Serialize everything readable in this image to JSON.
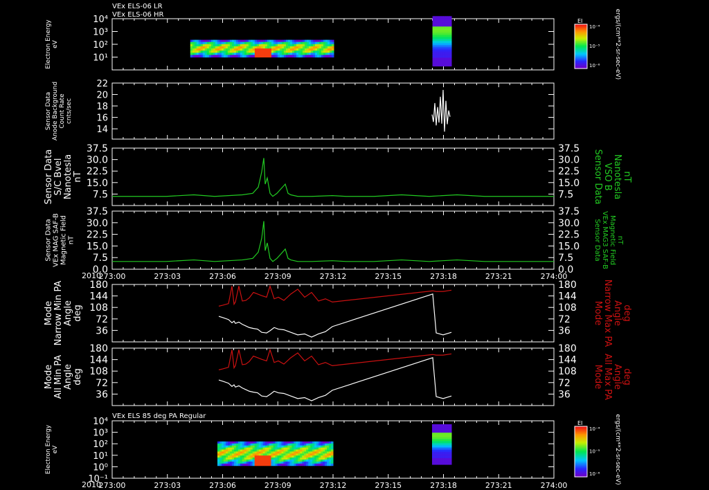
{
  "colors": {
    "background": "#000000",
    "axis": "#ffffff",
    "mag": "#22cc22",
    "maxpa": "#cc1111",
    "minpa": "#ffffff",
    "green_label": "#22cc22",
    "red_label": "#cc1111"
  },
  "header": {
    "line1": "VEx ELS-06 LR",
    "line2": "VEx ELS-06 HR"
  },
  "bottom_title": "VEx ELS 85 deg PA Regular",
  "time_axis": {
    "year": "2010",
    "ticks": [
      "273:00",
      "273:03",
      "273:06",
      "273:09",
      "273:12",
      "273:15",
      "273:18",
      "273:21",
      "274:00"
    ]
  },
  "colorbar": {
    "label": "EI",
    "units": "ergs/(cm**2-sr-sec-eV)",
    "ticks": [
      "10⁻⁴",
      "10⁻⁵",
      "10⁻⁶"
    ]
  },
  "chart_data": [
    {
      "type": "heatmap",
      "name": "p1",
      "ylabel": [
        "Electron Energy",
        "eV"
      ],
      "log": true,
      "ylim_exp": [
        0,
        4
      ],
      "yticks": [
        "10⁴",
        "10³",
        "10²",
        "10¹"
      ],
      "y_exp": [
        4,
        3,
        2,
        1
      ],
      "blocks": [
        {
          "t0": 274.8,
          "t1": 482,
          "e0": 1,
          "e1": 2.35
        },
        {
          "t0": 624.6,
          "t1": 652,
          "e0": 0.3,
          "e1": 4.2
        }
      ]
    },
    {
      "type": "line",
      "name": "p2",
      "ylabel": [
        "Sensor Data",
        "Anode Background",
        "Count Rate",
        "cnts/sec"
      ],
      "ylim": [
        12.2,
        22
      ],
      "yticks": [
        "22",
        "20",
        "18",
        "16",
        "14"
      ],
      "yvals": [
        22,
        20,
        18,
        16,
        14
      ],
      "x": [
        624,
        626,
        628,
        630,
        632,
        634,
        636,
        638,
        640,
        642,
        644,
        646,
        648,
        650
      ],
      "y": [
        16.5,
        15.2,
        18.5,
        14.6,
        17.8,
        15.1,
        19.6,
        14.9,
        20.8,
        13.5,
        18.9,
        14.8,
        17.2,
        16.1
      ]
    },
    {
      "type": "line",
      "name": "p3",
      "ylabel": [
        "Sensor Data",
        "S/C Bvel",
        "Nanotesla",
        "nT"
      ],
      "right_label": [
        "Sensor Data",
        "VSO B",
        "Nanotesla",
        "nT"
      ],
      "ylim": [
        0,
        37.5
      ],
      "yticks": [
        "37.5",
        "30.0",
        "22.5",
        "15.0",
        "7.5"
      ],
      "yvals": [
        37.5,
        30,
        22.5,
        15,
        7.5
      ],
      "x": [
        162,
        200,
        240,
        280,
        310,
        330,
        350,
        365,
        373,
        378,
        381,
        383,
        386,
        390,
        394,
        400,
        406,
        412,
        416,
        420,
        430,
        450,
        480,
        500,
        540,
        580,
        620,
        660,
        700,
        740,
        780,
        800
      ],
      "y": [
        6,
        6,
        6,
        7,
        6,
        6.5,
        7,
        8,
        12,
        22,
        31,
        14,
        18,
        8,
        6,
        8,
        11,
        14,
        8,
        7,
        6,
        6,
        6.5,
        6,
        6,
        7,
        6,
        7,
        6,
        6,
        6,
        6
      ]
    },
    {
      "type": "line",
      "name": "p4",
      "ylabel": [
        "Sensor Data",
        "VEx MAG SAF-B",
        "Magnetic Field",
        "nT"
      ],
      "right_label": [
        "Sensor Data",
        "VEx MAG3 SAF-B",
        "Magnetic Field",
        "nT"
      ],
      "ylim": [
        0,
        37.5
      ],
      "yticks": [
        "37.5",
        "30.0",
        "22.5",
        "15.0",
        "7.5",
        "0.0"
      ],
      "yvals": [
        37.5,
        30,
        22.5,
        15,
        7.5,
        0
      ],
      "x": [
        162,
        200,
        240,
        280,
        310,
        330,
        350,
        365,
        373,
        378,
        381,
        383,
        386,
        390,
        394,
        400,
        406,
        412,
        416,
        420,
        430,
        450,
        480,
        500,
        540,
        580,
        620,
        660,
        700,
        740,
        780,
        800
      ],
      "y": [
        5,
        5,
        5,
        6,
        5,
        5.5,
        6,
        7,
        11,
        20,
        31,
        12,
        17,
        7,
        5,
        7,
        10,
        13,
        7,
        6,
        5,
        5,
        5.5,
        5,
        5,
        6,
        5,
        6,
        5,
        5,
        5,
        5
      ]
    },
    {
      "type": "line",
      "name": "p5",
      "ylabel": [
        "Mode",
        "Narrow Min PA",
        "Angle",
        "deg"
      ],
      "right_label": [
        "Mode",
        "Narrow Max PA",
        "Angle",
        "deg"
      ],
      "ylim": [
        0,
        180
      ],
      "yticks": [
        "180",
        "144",
        "108",
        "72",
        "36"
      ],
      "yvals": [
        180,
        144,
        108,
        72,
        36
      ],
      "series": [
        {
          "name": "max",
          "x": [
            316,
            322,
            330,
            335,
            338,
            340,
            345,
            350,
            355,
            360,
            366,
            372,
            378,
            385,
            390,
            396,
            402,
            410,
            420,
            430,
            440,
            450,
            460,
            470,
            480,
            625,
            630,
            640,
            652
          ],
          "y": [
            112,
            115,
            120,
            175,
            118,
            125,
            175,
            128,
            130,
            138,
            155,
            150,
            145,
            140,
            175,
            135,
            140,
            130,
            150,
            165,
            140,
            155,
            128,
            135,
            125,
            160,
            158,
            158,
            162
          ]
        },
        {
          "name": "min",
          "x": [
            316,
            322,
            330,
            335,
            338,
            340,
            345,
            350,
            355,
            360,
            366,
            372,
            378,
            385,
            390,
            396,
            402,
            410,
            420,
            430,
            440,
            450,
            460,
            470,
            480,
            625,
            630,
            640,
            652
          ],
          "y": [
            80,
            76,
            70,
            60,
            65,
            58,
            62,
            55,
            50,
            45,
            42,
            40,
            30,
            28,
            35,
            45,
            40,
            38,
            30,
            22,
            25,
            15,
            25,
            32,
            48,
            150,
            28,
            22,
            30
          ]
        }
      ]
    },
    {
      "type": "line",
      "name": "p6",
      "ylabel": [
        "Mode",
        "All Min PA",
        "Angle",
        "deg"
      ],
      "right_label": [
        "Mode",
        "All Max PA",
        "Angle",
        "deg"
      ],
      "ylim": [
        0,
        180
      ],
      "yticks": [
        "180",
        "144",
        "108",
        "72",
        "36"
      ],
      "yvals": [
        180,
        144,
        108,
        72,
        36
      ],
      "series": [
        {
          "name": "max",
          "x": [
            316,
            322,
            330,
            335,
            338,
            340,
            345,
            350,
            355,
            360,
            366,
            372,
            378,
            385,
            390,
            396,
            402,
            410,
            420,
            430,
            440,
            450,
            460,
            470,
            480,
            625,
            630,
            640,
            652
          ],
          "y": [
            112,
            115,
            120,
            175,
            118,
            125,
            175,
            128,
            130,
            138,
            155,
            150,
            145,
            140,
            175,
            135,
            140,
            130,
            150,
            165,
            140,
            155,
            128,
            135,
            125,
            160,
            158,
            158,
            162
          ]
        },
        {
          "name": "min",
          "x": [
            316,
            322,
            330,
            335,
            338,
            340,
            345,
            350,
            355,
            360,
            366,
            372,
            378,
            385,
            390,
            396,
            402,
            410,
            420,
            430,
            440,
            450,
            460,
            470,
            480,
            625,
            630,
            640,
            652
          ],
          "y": [
            80,
            76,
            70,
            60,
            65,
            58,
            62,
            55,
            50,
            45,
            42,
            40,
            30,
            28,
            35,
            45,
            40,
            38,
            30,
            22,
            25,
            15,
            25,
            32,
            48,
            150,
            28,
            22,
            30
          ]
        }
      ]
    },
    {
      "type": "heatmap",
      "name": "p7",
      "ylabel": [
        "Electron Energy",
        "eV"
      ],
      "log": true,
      "ylim_exp": [
        -1,
        4
      ],
      "yticks": [
        "10⁴",
        "10³",
        "10²",
        "10¹",
        "10⁰",
        "10⁻¹"
      ],
      "y_exp": [
        4,
        3,
        2,
        1,
        0,
        -1
      ],
      "blocks": [
        {
          "t0": 314,
          "t1": 481,
          "e0": 0.1,
          "e1": 2.2
        },
        {
          "t0": 624,
          "t1": 652,
          "e0": 0.2,
          "e1": 3.7
        }
      ]
    }
  ]
}
